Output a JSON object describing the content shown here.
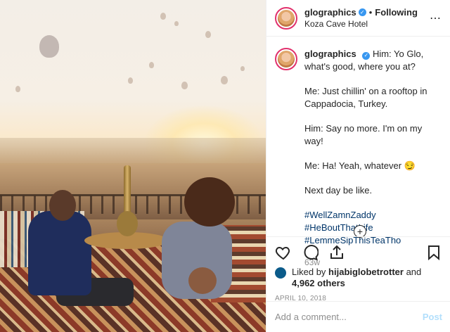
{
  "header": {
    "username": "glographics",
    "verified_icon": "verified-badge-icon",
    "separator": "•",
    "follow_status": "Following",
    "location": "Koza Cave Hotel",
    "more_icon": "more-options-icon"
  },
  "caption": {
    "username": "glographics",
    "lines": [
      "Him: Yo Glo, what's good, where you at?",
      "Me: Just chillin' on a rooftop in Cappadocia, Turkey.",
      "Him: Say no more. I'm on my way!",
      "Me: Ha! Yeah, whatever 😏",
      "Next day be like."
    ],
    "hashtags": [
      "#WellZamnZaddy",
      "#HeBoutThatLife",
      "#LemmeSipThisTeaTho"
    ],
    "time_ago": "63w",
    "load_more_icon": "plus-circle-icon"
  },
  "actions": {
    "like_icon": "heart-icon",
    "comment_icon": "comment-icon",
    "share_icon": "share-icon",
    "save_icon": "bookmark-icon"
  },
  "likes": {
    "prefix": "Liked by",
    "user": "hijabiglobetrotter",
    "and": "and",
    "others": "4,962 others"
  },
  "date": "APRIL 10, 2018",
  "comment_box": {
    "placeholder": "Add a comment...",
    "post_label": "Post"
  },
  "colors": {
    "link_blue": "#003569",
    "verified_blue": "#3897f0",
    "post_disabled": "#b2dffc",
    "meta_gray": "#8e8e8e"
  }
}
